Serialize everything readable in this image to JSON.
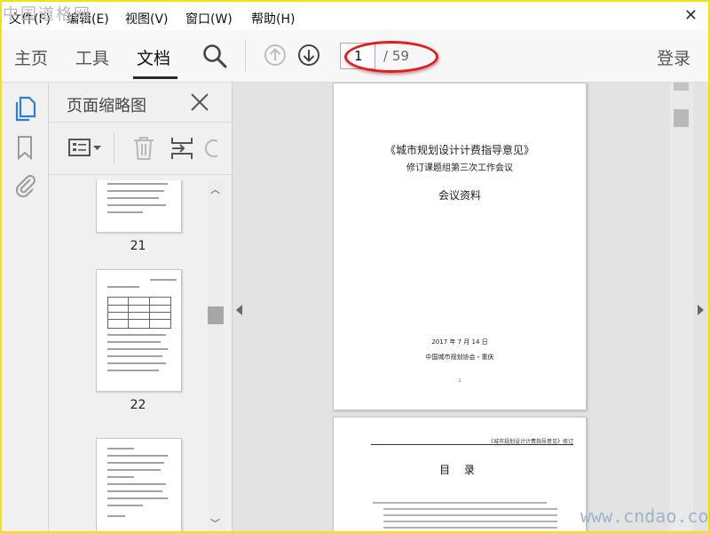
{
  "menu": {
    "items": [
      "文件(F)",
      "编辑(E)",
      "视图(V)",
      "窗口(W)",
      "帮助(H)"
    ],
    "close_glyph": "✕"
  },
  "watermark_top": "中国道格网",
  "watermark_bottom": "www.cndao.com",
  "toolbar": {
    "tabs": [
      "主页",
      "工具",
      "文档"
    ],
    "active_tab": "文档",
    "search_icon": "search-icon",
    "current_page": "1",
    "total_pages": "/ 59",
    "login": "登录"
  },
  "thumbnail_panel": {
    "title": "页面缩略图",
    "thumbnails": [
      {
        "label": "21"
      },
      {
        "label": "22"
      },
      {
        "label": ""
      }
    ]
  },
  "document": {
    "page1": {
      "title_line1": "《城市规划设计计费指导意见》",
      "title_line2": "修订课题组第三次工作会议",
      "title_line3": "会议资料",
      "date": "2017 年 7 月 14 日",
      "org": "中国城市规划协会・重庆",
      "page_number": "1"
    },
    "page2": {
      "header": "《城市规划设计计费指导意见》修订",
      "toc_title": "目 录"
    }
  },
  "colors": {
    "annotation_oval": "#e01e1e",
    "frame_border": "#f4e20a"
  }
}
